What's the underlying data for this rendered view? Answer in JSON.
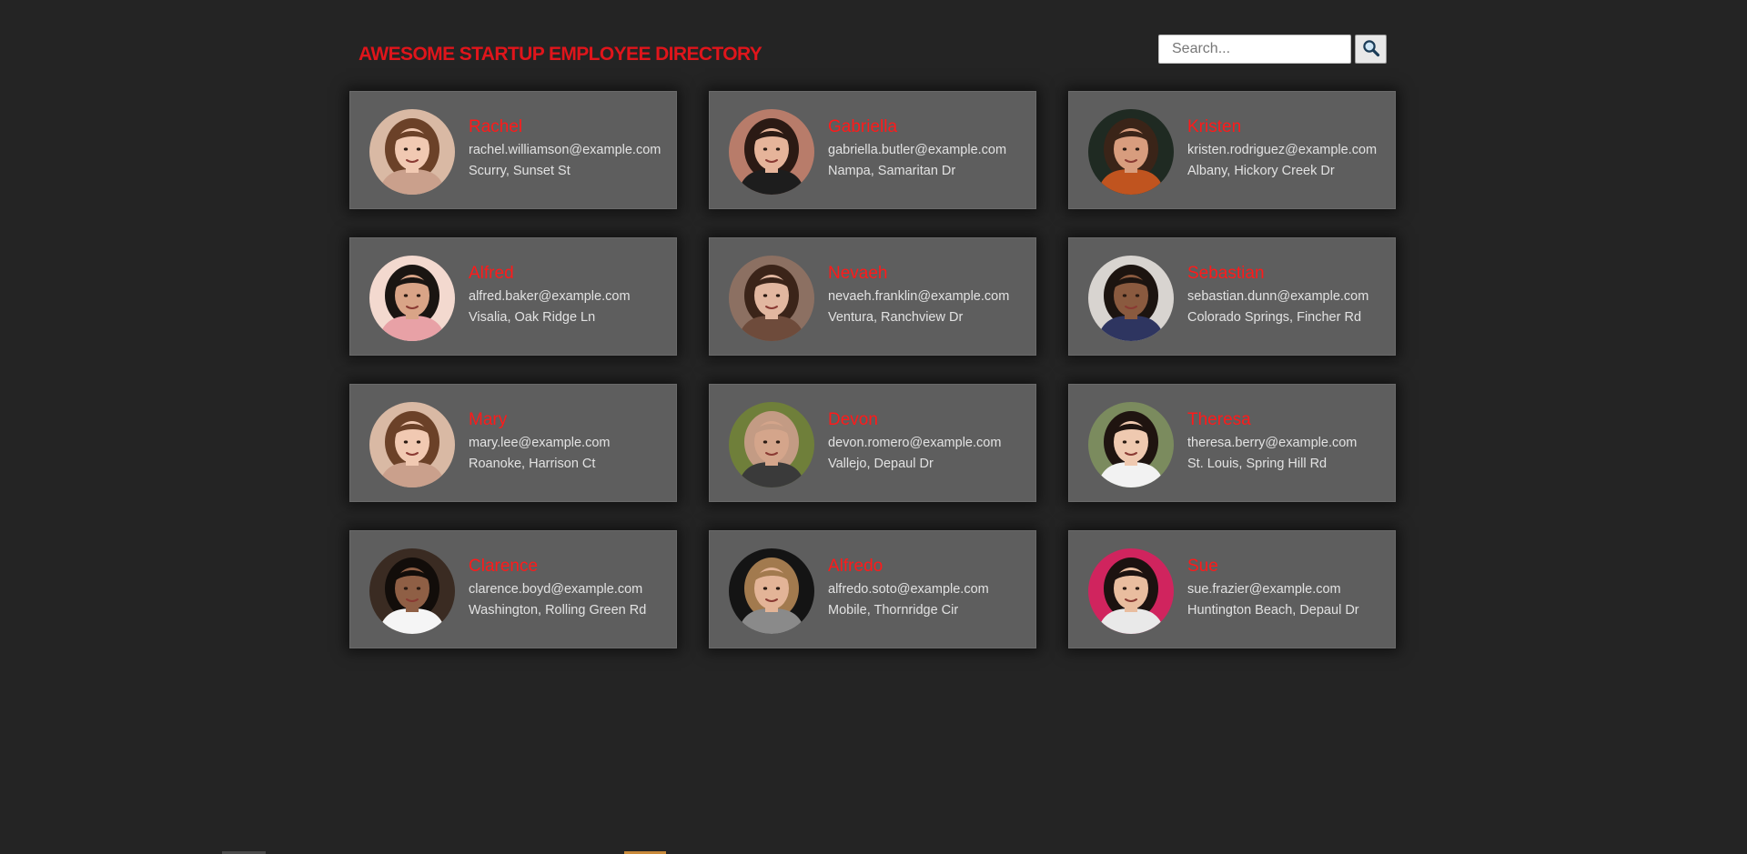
{
  "header": {
    "title": "AWESOME STARTUP EMPLOYEE DIRECTORY",
    "search_placeholder": "Search...",
    "search_icon": "magnifying-glass-icon"
  },
  "employees": [
    {
      "name": "Rachel",
      "email": "rachel.williamson@example.com",
      "location": "Scurry, Sunset St",
      "avatar": {
        "bg": "#d9b9a4",
        "hair": "#6b4128",
        "skin": "#f1c9b2",
        "shirt": "#caa08c"
      }
    },
    {
      "name": "Gabriella",
      "email": "gabriella.butler@example.com",
      "location": "Nampa, Samaritan Dr",
      "avatar": {
        "bg": "#b87c6a",
        "hair": "#2b1a14",
        "skin": "#e6b49a",
        "shirt": "#1d1d1d"
      }
    },
    {
      "name": "Kristen",
      "email": "kristen.rodriguez@example.com",
      "location": "Albany, Hickory Creek Dr",
      "avatar": {
        "bg": "#1f2a22",
        "hair": "#3a2418",
        "skin": "#d89d7e",
        "shirt": "#c0541f"
      }
    },
    {
      "name": "Alfred",
      "email": "alfred.baker@example.com",
      "location": "Visalia, Oak Ridge Ln",
      "avatar": {
        "bg": "#f3d9cf",
        "hair": "#1a1512",
        "skin": "#d9a487",
        "shirt": "#e8a1a6"
      }
    },
    {
      "name": "Nevaeh",
      "email": "nevaeh.franklin@example.com",
      "location": "Ventura, Ranchview Dr",
      "avatar": {
        "bg": "#8c7062",
        "hair": "#3b2419",
        "skin": "#e2b7a0",
        "shirt": "#6e4b3b"
      }
    },
    {
      "name": "Sebastian",
      "email": "sebastian.dunn@example.com",
      "location": "Colorado Springs, Fincher Rd",
      "avatar": {
        "bg": "#d8d4d0",
        "hair": "#1c1410",
        "skin": "#8a5a3f",
        "shirt": "#2e3560"
      }
    },
    {
      "name": "Mary",
      "email": "mary.lee@example.com",
      "location": "Roanoke, Harrison Ct",
      "avatar": {
        "bg": "#d9b9a4",
        "hair": "#6b4128",
        "skin": "#f1c9b2",
        "shirt": "#caa08c"
      }
    },
    {
      "name": "Devon",
      "email": "devon.romero@example.com",
      "location": "Vallejo, Depaul Dr",
      "avatar": {
        "bg": "#6f7f3a",
        "hair": "#c39b84",
        "skin": "#d4a58b",
        "shirt": "#3a3a3a"
      }
    },
    {
      "name": "Theresa",
      "email": "theresa.berry@example.com",
      "location": "St. Louis, Spring Hill Rd",
      "avatar": {
        "bg": "#7b8b5e",
        "hair": "#1f1410",
        "skin": "#efc9b0",
        "shirt": "#f2f2f2"
      }
    },
    {
      "name": "Clarence",
      "email": "clarence.boyd@example.com",
      "location": "Washington, Rolling Green Rd",
      "avatar": {
        "bg": "#3a2b22",
        "hair": "#120d0a",
        "skin": "#8f5f45",
        "shirt": "#f5f5f5"
      }
    },
    {
      "name": "Alfredo",
      "email": "alfredo.soto@example.com",
      "location": "Mobile, Thornridge Cir",
      "avatar": {
        "bg": "#141414",
        "hair": "#a27a4e",
        "skin": "#e3b497",
        "shirt": "#8a8a8a"
      }
    },
    {
      "name": "Sue",
      "email": "sue.frazier@example.com",
      "location": "Huntington Beach, Depaul Dr",
      "avatar": {
        "bg": "#d0245e",
        "hair": "#1c1210",
        "skin": "#e9bd9f",
        "shirt": "#e9e9e9"
      }
    }
  ],
  "colors": {
    "background": "#242424",
    "card": "#5e5e5e",
    "accent": "#ff1a1a"
  }
}
